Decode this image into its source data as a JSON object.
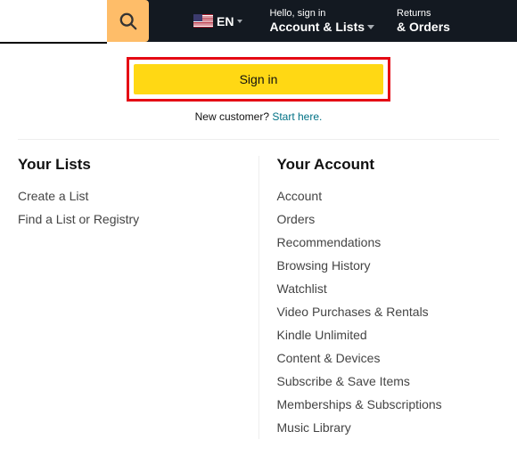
{
  "nav": {
    "lang": "EN",
    "account_greeting": "Hello, sign in",
    "account_label": "Account & Lists",
    "returns_top": "Returns",
    "returns_bottom": "& Orders"
  },
  "flyout": {
    "signin_label": "Sign in",
    "newcust_text": "New customer? ",
    "newcust_link": "Start here."
  },
  "lists": {
    "heading": "Your Lists",
    "items": [
      "Create a List",
      "Find a List or Registry"
    ]
  },
  "account": {
    "heading": "Your Account",
    "items": [
      "Account",
      "Orders",
      "Recommendations",
      "Browsing History",
      "Watchlist",
      "Video Purchases & Rentals",
      "Kindle Unlimited",
      "Content & Devices",
      "Subscribe & Save Items",
      "Memberships & Subscriptions",
      "Music Library"
    ]
  }
}
